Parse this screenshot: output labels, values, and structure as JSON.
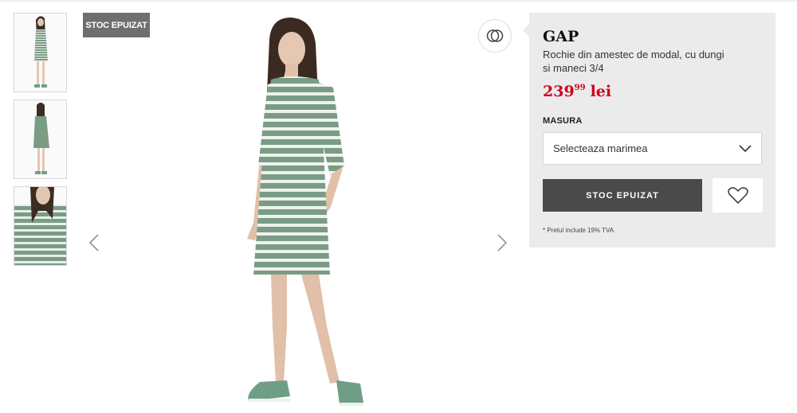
{
  "product": {
    "badge": "STOC EPUIZAT",
    "brand": "GAP",
    "name": "Rochie din amestec de modal, cu dungi si maneci 3/4",
    "price_main": "239",
    "price_cents": "99",
    "currency": "lei"
  },
  "size": {
    "label": "MASURA",
    "placeholder": "Selecteaza marimea"
  },
  "actions": {
    "soldout_label": "STOC EPUIZAT"
  },
  "note": "* Pretul include 19% TVA",
  "icons": {
    "share": "share-rings-icon",
    "wishlist": "heart-icon",
    "dropdown": "chevron-down-icon",
    "prev": "chevron-left-icon",
    "next": "chevron-right-icon"
  },
  "colors": {
    "badge_bg": "#6f6f6f",
    "panel_bg": "#ebebeb",
    "price": "#d0021b",
    "button_bg": "#4a4a4a",
    "dress_green": "#7a9c84",
    "shoe_green": "#6f9e87"
  }
}
